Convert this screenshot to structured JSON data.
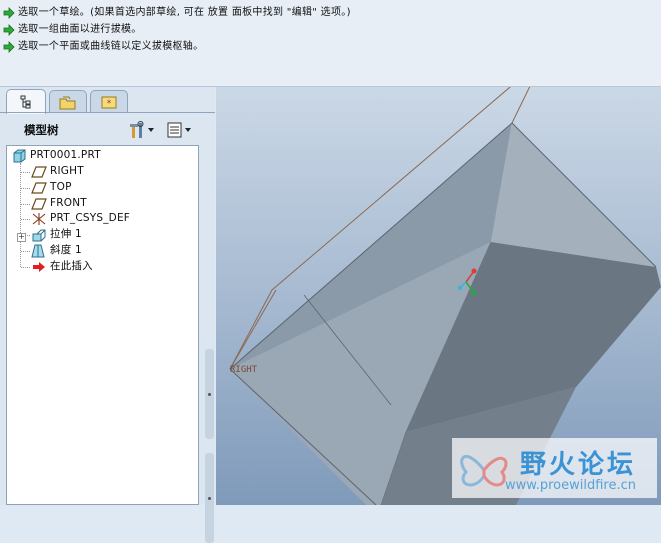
{
  "messages": [
    "选取一个草绘。(如果首选内部草绘, 可在 放置 面板中找到 \"编辑\" 选项。)",
    "选取一组曲面以进行拔模。",
    "选取一个平面或曲线链以定义拔模枢轴。"
  ],
  "panel": {
    "tabs": [
      "model-tree-tab",
      "folder-browser-tab",
      "favorites-tab"
    ],
    "title": "模型树"
  },
  "tree": {
    "items": [
      {
        "label": "PRT0001.PRT",
        "icon": "part-icon"
      },
      {
        "label": "RIGHT",
        "icon": "datum-plane-icon"
      },
      {
        "label": "TOP",
        "icon": "datum-plane-icon"
      },
      {
        "label": "FRONT",
        "icon": "datum-plane-icon"
      },
      {
        "label": "PRT_CSYS_DEF",
        "icon": "csys-icon"
      },
      {
        "label": "拉伸 1",
        "icon": "extrude-icon"
      },
      {
        "label": "斜度 1",
        "icon": "draft-icon"
      },
      {
        "label": "在此插入",
        "icon": "insert-here-icon"
      }
    ]
  },
  "viewport": {
    "datum_label": "RIGHT"
  },
  "watermark": {
    "title": "野火论坛",
    "url": "www.proewildfire.cn"
  },
  "colors": {
    "msg_arrow": "#2faa3a",
    "insert_arrow": "#e02020",
    "watermark_blue": "#3a93d4"
  }
}
